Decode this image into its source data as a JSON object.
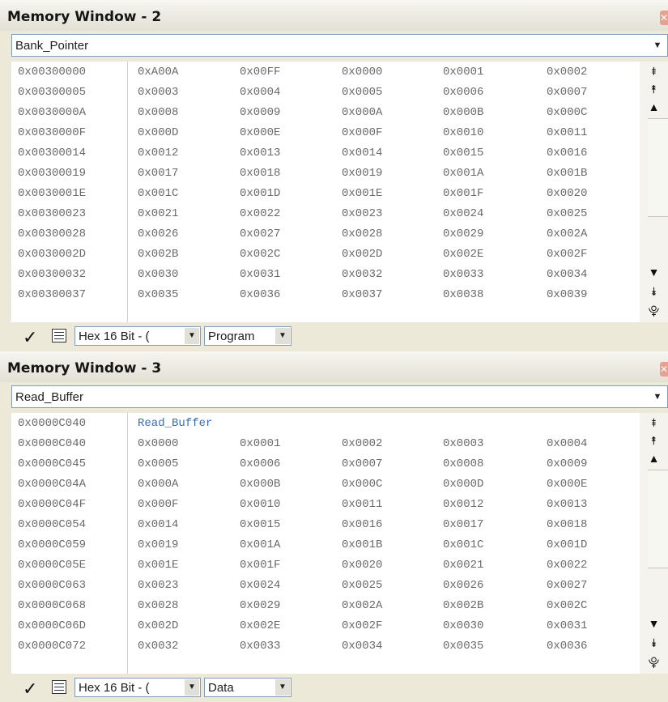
{
  "windows": [
    {
      "title": "Memory Window - 2",
      "symbol": "Bank_Pointer",
      "label_row": "",
      "format": "Hex 16 Bit - (",
      "memtype": "Program",
      "rows": [
        {
          "addr": "0x00300000",
          "v": [
            "0xA00A",
            "0x00FF",
            "0x0000",
            "0x0001",
            "0x0002"
          ]
        },
        {
          "addr": "0x00300005",
          "v": [
            "0x0003",
            "0x0004",
            "0x0005",
            "0x0006",
            "0x0007"
          ]
        },
        {
          "addr": "0x0030000A",
          "v": [
            "0x0008",
            "0x0009",
            "0x000A",
            "0x000B",
            "0x000C"
          ]
        },
        {
          "addr": "0x0030000F",
          "v": [
            "0x000D",
            "0x000E",
            "0x000F",
            "0x0010",
            "0x0011"
          ]
        },
        {
          "addr": "0x00300014",
          "v": [
            "0x0012",
            "0x0013",
            "0x0014",
            "0x0015",
            "0x0016"
          ]
        },
        {
          "addr": "0x00300019",
          "v": [
            "0x0017",
            "0x0018",
            "0x0019",
            "0x001A",
            "0x001B"
          ]
        },
        {
          "addr": "0x0030001E",
          "v": [
            "0x001C",
            "0x001D",
            "0x001E",
            "0x001F",
            "0x0020"
          ]
        },
        {
          "addr": "0x00300023",
          "v": [
            "0x0021",
            "0x0022",
            "0x0023",
            "0x0024",
            "0x0025"
          ]
        },
        {
          "addr": "0x00300028",
          "v": [
            "0x0026",
            "0x0027",
            "0x0028",
            "0x0029",
            "0x002A"
          ]
        },
        {
          "addr": "0x0030002D",
          "v": [
            "0x002B",
            "0x002C",
            "0x002D",
            "0x002E",
            "0x002F"
          ]
        },
        {
          "addr": "0x00300032",
          "v": [
            "0x0030",
            "0x0031",
            "0x0032",
            "0x0033",
            "0x0034"
          ]
        },
        {
          "addr": "0x00300037",
          "v": [
            "0x0035",
            "0x0036",
            "0x0037",
            "0x0038",
            "0x0039"
          ]
        }
      ]
    },
    {
      "title": "Memory Window - 3",
      "symbol": "Read_Buffer",
      "label_row": {
        "addr": "0x0000C040",
        "label": "Read_Buffer"
      },
      "format": "Hex 16 Bit - (",
      "memtype": "Data",
      "rows": [
        {
          "addr": "0x0000C040",
          "v": [
            "0x0000",
            "0x0001",
            "0x0002",
            "0x0003",
            "0x0004"
          ]
        },
        {
          "addr": "0x0000C045",
          "v": [
            "0x0005",
            "0x0006",
            "0x0007",
            "0x0008",
            "0x0009"
          ]
        },
        {
          "addr": "0x0000C04A",
          "v": [
            "0x000A",
            "0x000B",
            "0x000C",
            "0x000D",
            "0x000E"
          ]
        },
        {
          "addr": "0x0000C04F",
          "v": [
            "0x000F",
            "0x0010",
            "0x0011",
            "0x0012",
            "0x0013"
          ]
        },
        {
          "addr": "0x0000C054",
          "v": [
            "0x0014",
            "0x0015",
            "0x0016",
            "0x0017",
            "0x0018"
          ]
        },
        {
          "addr": "0x0000C059",
          "v": [
            "0x0019",
            "0x001A",
            "0x001B",
            "0x001C",
            "0x001D"
          ]
        },
        {
          "addr": "0x0000C05E",
          "v": [
            "0x001E",
            "0x001F",
            "0x0020",
            "0x0021",
            "0x0022"
          ]
        },
        {
          "addr": "0x0000C063",
          "v": [
            "0x0023",
            "0x0024",
            "0x0025",
            "0x0026",
            "0x0027"
          ]
        },
        {
          "addr": "0x0000C068",
          "v": [
            "0x0028",
            "0x0029",
            "0x002A",
            "0x002B",
            "0x002C"
          ]
        },
        {
          "addr": "0x0000C06D",
          "v": [
            "0x002D",
            "0x002E",
            "0x002F",
            "0x0030",
            "0x0031"
          ]
        },
        {
          "addr": "0x0000C072",
          "v": [
            "0x0032",
            "0x0033",
            "0x0034",
            "0x0035",
            "0x0036"
          ]
        }
      ]
    }
  ],
  "icons": {
    "scroll_top": "scroll-top-icon",
    "page_up": "page-up-icon",
    "line_up": "line-up-icon",
    "line_down": "line-down-icon",
    "page_down": "page-down-icon",
    "scroll_bottom": "scroll-bottom-icon",
    "apply": "checkmark-icon",
    "options": "list-icon"
  }
}
